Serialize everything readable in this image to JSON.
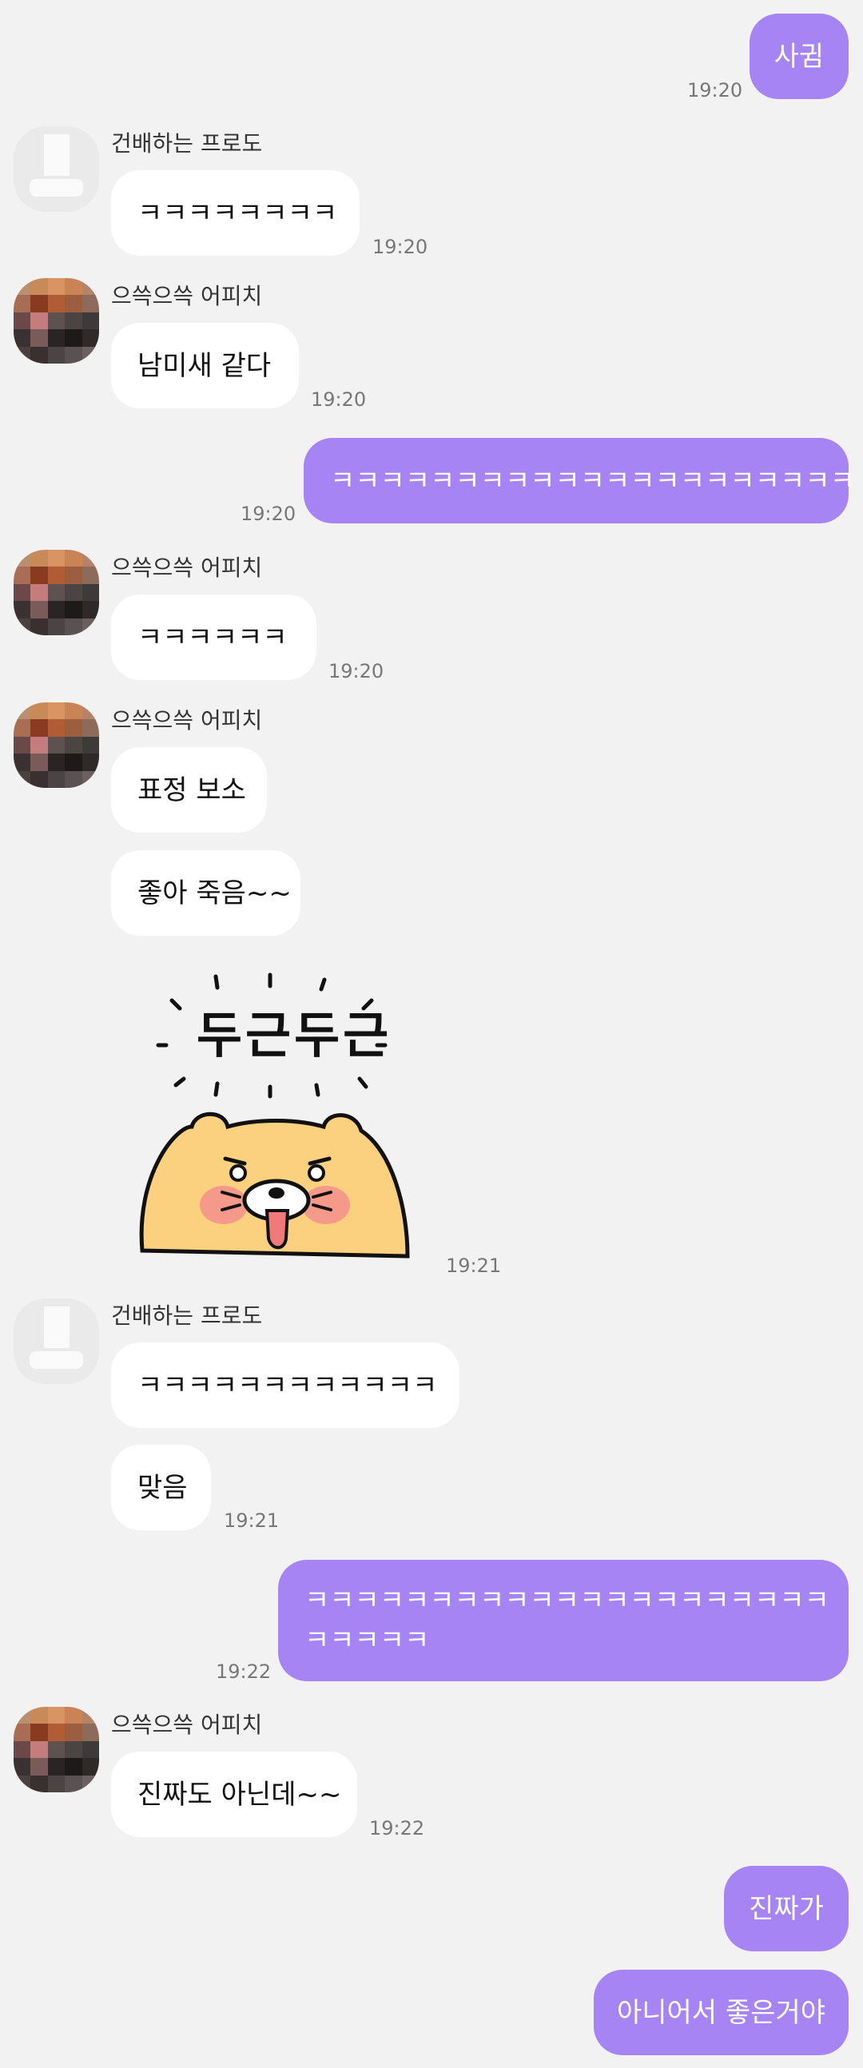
{
  "colors": {
    "background": "#f2f2f3",
    "outgoing": "#a784f3",
    "incoming": "#ffffff"
  },
  "names": {
    "frodo": "건배하는 프로도",
    "apeach": "으쓱으쓱 어피치"
  },
  "messages": {
    "m1": {
      "text": "사귐",
      "time": "19:20"
    },
    "m2": {
      "text": "ㅋㅋㅋㅋㅋㅋㅋㅋ",
      "time": "19:20"
    },
    "m3": {
      "text": "남미새 같다",
      "time": "19:20"
    },
    "m4": {
      "text": "ㅋㅋㅋㅋㅋㅋㅋㅋㅋㅋㅋㅋㅋㅋㅋㅋㅋㅋㅋㅋㅋ",
      "time": "19:20"
    },
    "m5": {
      "text": "ㅋㅋㅋㅋㅋㅋ",
      "time": "19:20"
    },
    "m6": {
      "text": "표정 보소"
    },
    "m7": {
      "text": "좋아 죽음~~"
    },
    "sticker": {
      "text": "두근두근",
      "icon": "blushing-ryan-sticker",
      "time": "19:21"
    },
    "m8": {
      "text": "ㅋㅋㅋㅋㅋㅋㅋㅋㅋㅋㅋㅋ"
    },
    "m9": {
      "text": "맞음",
      "time": "19:21"
    },
    "m10": {
      "line1": "ㅋㅋㅋㅋㅋㅋㅋㅋㅋㅋㅋㅋㅋㅋㅋㅋㅋㅋㅋㅋㅋ",
      "line2": "ㅋㅋㅋㅋㅋ",
      "time": "19:22"
    },
    "m11": {
      "text": "진짜도 아닌데~~",
      "time": "19:22"
    },
    "m12": {
      "text": "진짜가"
    },
    "m13": {
      "text": "아니어서 좋은거야"
    }
  }
}
